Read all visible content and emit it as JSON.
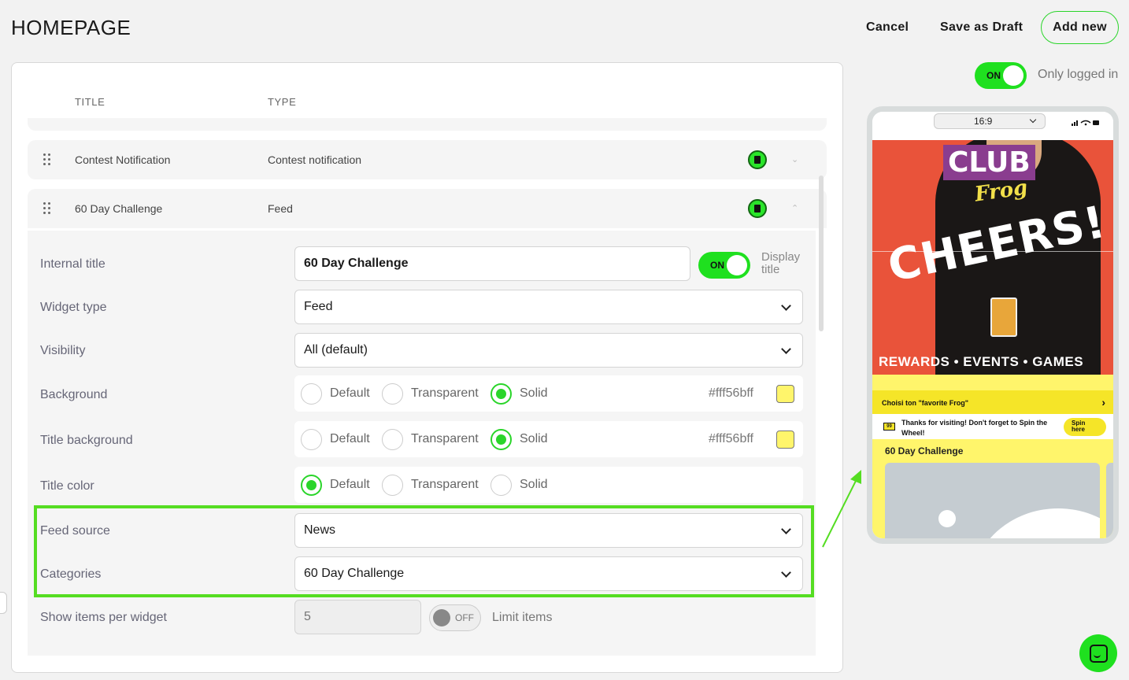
{
  "header": {
    "title": "HOMEPAGE",
    "cancel_label": "Cancel",
    "draft_label": "Save as Draft",
    "add_label": "Add new"
  },
  "visibility_toggle": {
    "state": "ON",
    "label": "Only logged in"
  },
  "table": {
    "columns": [
      "TITLE",
      "TYPE"
    ],
    "rows": [
      {
        "title": "Contest Notification",
        "type": "Contest notification",
        "expanded": false
      },
      {
        "title": "60 Day Challenge",
        "type": "Feed",
        "expanded": true
      }
    ]
  },
  "form": {
    "internal_title": {
      "label": "Internal title",
      "value": "60 Day Challenge"
    },
    "display_title": {
      "state": "ON",
      "label": "Display title"
    },
    "widget_type": {
      "label": "Widget type",
      "value": "Feed"
    },
    "visibility": {
      "label": "Visibility",
      "value": "All (default)"
    },
    "background": {
      "label": "Background",
      "options": [
        "Default",
        "Transparent",
        "Solid"
      ],
      "selected": "Solid",
      "hex": "#fff56bff",
      "swatch_color": "#fff56b"
    },
    "title_background": {
      "label": "Title background",
      "options": [
        "Default",
        "Transparent",
        "Solid"
      ],
      "selected": "Solid",
      "hex": "#fff56bff",
      "swatch_color": "#fff56b"
    },
    "title_color": {
      "label": "Title color",
      "options": [
        "Default",
        "Transparent",
        "Solid"
      ],
      "selected": "Default"
    },
    "feed_source": {
      "label": "Feed source",
      "value": "News"
    },
    "categories": {
      "label": "Categories",
      "value": "60 Day Challenge"
    },
    "items_per_widget": {
      "label": "Show items per widget",
      "placeholder": "5",
      "limit_state": "OFF",
      "limit_label": "Limit items"
    }
  },
  "preview": {
    "aspect_ratio": "16:9",
    "hero": {
      "club": "CLUB",
      "frog": "Frog",
      "headline": "CHEERS!",
      "tagline": "REWARDS • EVENTS • GAMES"
    },
    "promo_banner": "Choisi ton \"favorite Frog\"",
    "notice": {
      "ticket": "99",
      "message": "Thanks for visiting! Don't forget to Spin the Wheel!",
      "button": "Spin here"
    },
    "feed_title": "60 Day Challenge"
  },
  "colors": {
    "accent": "#2ad52a",
    "toggle_on": "#1fe01f",
    "highlight": "#55dd22",
    "feed_bg": "#fff56b"
  },
  "icons": [
    "drag-handle-icon",
    "trash-icon",
    "chevron-down-icon",
    "chevron-up-icon",
    "chat-icon",
    "signal-icon",
    "wifi-icon",
    "battery-icon",
    "image-placeholder-icon",
    "arrow-icon"
  ]
}
